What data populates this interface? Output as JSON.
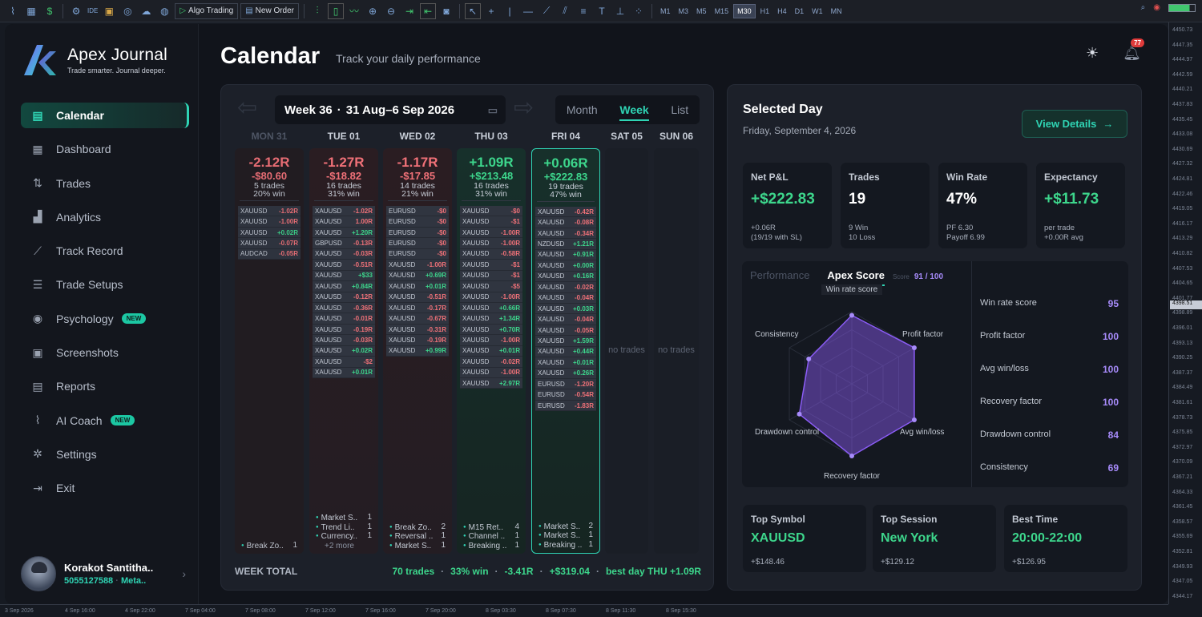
{
  "toolbar": {
    "algo_label": "Algo Trading",
    "new_order_label": "New Order",
    "ide_label": "IDE",
    "timeframes": [
      "M1",
      "M3",
      "M5",
      "M15",
      "M30",
      "H1",
      "H4",
      "D1",
      "W1",
      "MN"
    ],
    "active_timeframe": "M30"
  },
  "axis": {
    "prices": [
      "4450.73",
      "4447.35",
      "4444.97",
      "4442.59",
      "4440.21",
      "4437.83",
      "4435.45",
      "4433.08",
      "4430.69",
      "4427.32",
      "4424.81",
      "4422.46",
      "4419.05",
      "4416.17",
      "4413.29",
      "4410.82",
      "4407.53",
      "4404.65",
      "4401.77",
      "4398.89",
      "4396.01",
      "4393.13",
      "4390.25",
      "4387.37",
      "4384.49",
      "4381.61",
      "4378.73",
      "4375.85",
      "4372.97",
      "4370.09",
      "4367.21",
      "4364.33",
      "4361.45",
      "4358.57",
      "4355.69",
      "4352.81",
      "4349.93",
      "4347.05",
      "4344.17"
    ],
    "current_price": "4398.51",
    "dates": [
      "3 Sep 2026",
      "4 Sep 16:00",
      "4 Sep 22:00",
      "7 Sep 04:00",
      "7 Sep 08:00",
      "7 Sep 12:00",
      "7 Sep 16:00",
      "7 Sep 20:00",
      "8 Sep 03:30",
      "8 Sep 07:30",
      "8 Sep 11:30",
      "8 Sep 15:30"
    ]
  },
  "brand": {
    "name": "Apex Journal",
    "tagline": "Trade smarter. Journal deeper."
  },
  "nav": [
    {
      "label": "Calendar",
      "icon": "calendar-icon",
      "active": true
    },
    {
      "label": "Dashboard",
      "icon": "grid-icon"
    },
    {
      "label": "Trades",
      "icon": "arrows-icon"
    },
    {
      "label": "Analytics",
      "icon": "bar-chart-icon"
    },
    {
      "label": "Track Record",
      "icon": "trend-line-icon"
    },
    {
      "label": "Trade Setups",
      "icon": "sliders-icon"
    },
    {
      "label": "Psychology",
      "icon": "target-icon",
      "badge": "NEW"
    },
    {
      "label": "Screenshots",
      "icon": "image-icon"
    },
    {
      "label": "Reports",
      "icon": "document-icon"
    },
    {
      "label": "AI Coach",
      "icon": "pulse-icon",
      "badge": "NEW"
    },
    {
      "label": "Settings",
      "icon": "gear-icon"
    },
    {
      "label": "Exit",
      "icon": "exit-icon"
    }
  ],
  "user": {
    "name": "Korakot Santitha..",
    "id": "5055127588",
    "platform": "Meta.."
  },
  "header": {
    "title": "Calendar",
    "subtitle": "Track your daily performance",
    "notifications": "77"
  },
  "calendar": {
    "week_label": "Week 36",
    "range": "31 Aug–6 Sep 2026",
    "views": [
      "Month",
      "Week",
      "List"
    ],
    "active_view": "Week",
    "no_trades_text": "no trades",
    "days": [
      {
        "head": "MON 31",
        "dim": true,
        "r": "-2.12R",
        "usd": "-$80.60",
        "trades": "5 trades",
        "win": "20% win",
        "kind": "loss",
        "rows": [
          [
            "XAUUSD",
            "-1.02R"
          ],
          [
            "XAUUSD",
            "-1.00R"
          ],
          [
            "XAUUSD",
            "+0.02R"
          ],
          [
            "XAUUSD",
            "-0.07R"
          ],
          [
            "AUDCAD",
            "-0.05R"
          ]
        ],
        "setups": [
          [
            "Break Zo..",
            "1"
          ]
        ]
      },
      {
        "head": "TUE 01",
        "r": "-1.27R",
        "usd": "-$18.82",
        "trades": "16 trades",
        "win": "31% win",
        "kind": "loss",
        "rows": [
          [
            "XAUUSD",
            "-1.02R"
          ],
          [
            "XAUUSD",
            "1.00R"
          ],
          [
            "XAUUSD",
            "+1.20R"
          ],
          [
            "GBPUSD",
            "-0.13R"
          ],
          [
            "XAUUSD",
            "-0.03R"
          ],
          [
            "XAUUSD",
            "-0.51R"
          ],
          [
            "XAUUSD",
            "+$33"
          ],
          [
            "XAUUSD",
            "+0.84R"
          ],
          [
            "XAUUSD",
            "-0.12R"
          ],
          [
            "XAUUSD",
            "-0.36R"
          ],
          [
            "XAUUSD",
            "-0.01R"
          ],
          [
            "XAUUSD",
            "-0.19R"
          ],
          [
            "XAUUSD",
            "-0.03R"
          ],
          [
            "XAUUSD",
            "+0.02R"
          ],
          [
            "XAUUSD",
            "-$2"
          ],
          [
            "XAUUSD",
            "+0.01R"
          ]
        ],
        "setups": [
          [
            "Market S..",
            "1"
          ],
          [
            "Trend Li..",
            "1"
          ],
          [
            "Currency..",
            "1"
          ]
        ],
        "more": "+2 more"
      },
      {
        "head": "WED 02",
        "r": "-1.17R",
        "usd": "-$17.85",
        "trades": "14 trades",
        "win": "21% win",
        "kind": "loss",
        "rows": [
          [
            "EURUSD",
            "-$0"
          ],
          [
            "EURUSD",
            "-$0"
          ],
          [
            "EURUSD",
            "-$0"
          ],
          [
            "EURUSD",
            "-$0"
          ],
          [
            "EURUSD",
            "-$0"
          ],
          [
            "XAUUSD",
            "-1.00R"
          ],
          [
            "XAUUSD",
            "+0.69R"
          ],
          [
            "XAUUSD",
            "+0.01R"
          ],
          [
            "XAUUSD",
            "-0.51R"
          ],
          [
            "XAUUSD",
            "-0.17R"
          ],
          [
            "XAUUSD",
            "-0.67R"
          ],
          [
            "XAUUSD",
            "-0.31R"
          ],
          [
            "XAUUSD",
            "-0.19R"
          ],
          [
            "XAUUSD",
            "+0.99R"
          ]
        ],
        "setups": [
          [
            "Break Zo..",
            "2"
          ],
          [
            "Reversal ..",
            "1"
          ],
          [
            "Market S..",
            "1"
          ]
        ]
      },
      {
        "head": "THU 03",
        "r": "+1.09R",
        "usd": "+$213.48",
        "trades": "16 trades",
        "win": "31% win",
        "kind": "win",
        "rows": [
          [
            "XAUUSD",
            "-$0"
          ],
          [
            "XAUUSD",
            "-$1"
          ],
          [
            "XAUUSD",
            "-1.00R"
          ],
          [
            "XAUUSD",
            "-1.00R"
          ],
          [
            "XAUUSD",
            "-0.58R"
          ],
          [
            "XAUUSD",
            "-$1"
          ],
          [
            "XAUUSD",
            "-$1"
          ],
          [
            "XAUUSD",
            "-$5"
          ],
          [
            "XAUUSD",
            "-1.00R"
          ],
          [
            "XAUUSD",
            "+0.66R"
          ],
          [
            "XAUUSD",
            "+1.34R"
          ],
          [
            "XAUUSD",
            "+0.70R"
          ],
          [
            "XAUUSD",
            "-1.00R"
          ],
          [
            "XAUUSD",
            "+0.01R"
          ],
          [
            "XAUUSD",
            "-0.02R"
          ],
          [
            "XAUUSD",
            "-1.00R"
          ],
          [
            "XAUUSD",
            "+2.97R"
          ]
        ],
        "setups": [
          [
            "M15 Ret..",
            "4"
          ],
          [
            "Channel ..",
            "1"
          ],
          [
            "Breaking ..",
            "1"
          ]
        ]
      },
      {
        "head": "FRI 04",
        "r": "+0.06R",
        "usd": "+$222.83",
        "trades": "19 trades",
        "win": "47% win",
        "kind": "win",
        "selected": true,
        "rows": [
          [
            "XAUUSD",
            "-0.42R"
          ],
          [
            "XAUUSD",
            "-0.08R"
          ],
          [
            "XAUUSD",
            "-0.34R"
          ],
          [
            "NZDUSD",
            "+1.21R"
          ],
          [
            "XAUUSD",
            "+0.91R"
          ],
          [
            "XAUUSD",
            "+0.00R"
          ],
          [
            "XAUUSD",
            "+0.16R"
          ],
          [
            "XAUUSD",
            "-0.02R"
          ],
          [
            "XAUUSD",
            "-0.04R"
          ],
          [
            "XAUUSD",
            "+0.03R"
          ],
          [
            "XAUUSD",
            "-0.04R"
          ],
          [
            "XAUUSD",
            "-0.05R"
          ],
          [
            "XAUUSD",
            "+1.59R"
          ],
          [
            "XAUUSD",
            "+0.44R"
          ],
          [
            "XAUUSD",
            "+0.01R"
          ],
          [
            "XAUUSD",
            "+0.26R"
          ],
          [
            "EURUSD",
            "-1.20R"
          ],
          [
            "EURUSD",
            "-0.54R"
          ],
          [
            "EURUSD",
            "-1.83R"
          ]
        ],
        "setups": [
          [
            "Market S..",
            "2"
          ],
          [
            "Market S..",
            "1"
          ],
          [
            "Breaking ..",
            "1"
          ]
        ]
      },
      {
        "head": "SAT 05",
        "kind": "empty"
      },
      {
        "head": "SUN 06",
        "kind": "empty"
      }
    ],
    "week_total": {
      "label": "WEEK TOTAL",
      "trades": "70 trades",
      "win": "33% win",
      "r": "-3.41R",
      "usd": "+$319.04",
      "best": "best day THU +1.09R"
    }
  },
  "selected": {
    "title": "Selected Day",
    "date": "Friday, September 4, 2026",
    "view_details": "View Details",
    "stats": [
      {
        "label": "Net P&L",
        "value": "+$222.83",
        "pos": true,
        "sub1": "+0.06R",
        "sub2": "(19/19 with SL)"
      },
      {
        "label": "Trades",
        "value": "19",
        "sub1": "9 Win",
        "sub2": "10 Loss"
      },
      {
        "label": "Win Rate",
        "value": "47%",
        "sub1": "PF 6.30",
        "sub2": "Payoff 6.99"
      },
      {
        "label": "Expectancy",
        "value": "+$11.73",
        "pos": true,
        "sub1": "per trade",
        "sub2": "+0.00R avg"
      }
    ],
    "score": {
      "tab_performance": "Performance",
      "tab_apex": "Apex Score",
      "score_label": "Score",
      "score_value": "91 / 100",
      "axes": [
        {
          "name": "Win rate score",
          "value": 95
        },
        {
          "name": "Profit factor",
          "value": 100
        },
        {
          "name": "Avg win/loss",
          "value": 100
        },
        {
          "name": "Recovery factor",
          "value": 100
        },
        {
          "name": "Drawdown control",
          "value": 84
        },
        {
          "name": "Consistency",
          "value": 69
        }
      ],
      "color": "#8b5cf6"
    },
    "bottom": [
      {
        "label": "Top Symbol",
        "value": "XAUUSD",
        "sub": "+$148.46"
      },
      {
        "label": "Top Session",
        "value": "New York",
        "sub": "+$129.12"
      },
      {
        "label": "Best Time",
        "value": "20:00-22:00",
        "sub": "+$126.95"
      }
    ]
  }
}
